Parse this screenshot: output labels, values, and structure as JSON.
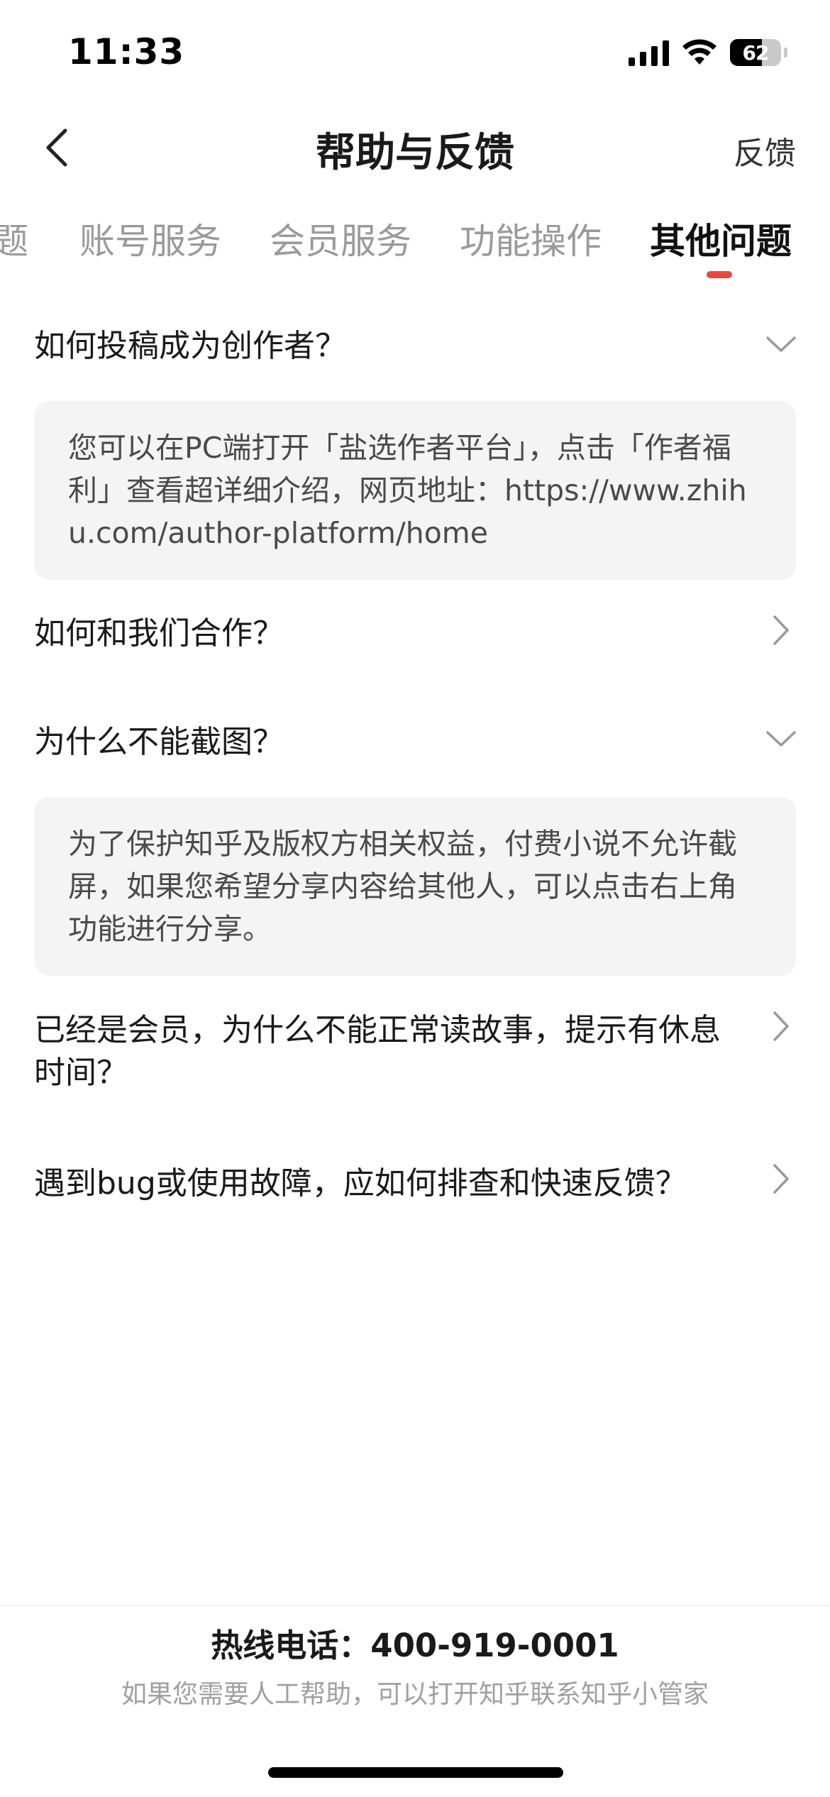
{
  "status_bar": {
    "time": "11:33",
    "battery_level": "62",
    "battery_fraction": 0.62,
    "icons": [
      "signal-icon",
      "wifi-icon",
      "battery-icon"
    ]
  },
  "nav": {
    "title": "帮助与反馈",
    "back_icon": "chevron-left-icon",
    "feedback_label": "反馈"
  },
  "tabs": [
    {
      "label": "题",
      "active": false
    },
    {
      "label": "账号服务",
      "active": false
    },
    {
      "label": "会员服务",
      "active": false
    },
    {
      "label": "功能操作",
      "active": false
    },
    {
      "label": "其他问题",
      "active": true
    }
  ],
  "faq": [
    {
      "question": "如何投稿成为创作者？",
      "expanded": true,
      "answer": "您可以在PC端打开「盐选作者平台」，点击「作者福利」查看超详细介绍，网页地址：https://www.zhihu.com/author-platform/home"
    },
    {
      "question": "如何和我们合作？",
      "expanded": false
    },
    {
      "question": "为什么不能截图？",
      "expanded": true,
      "answer": "为了保护知乎及版权方相关权益，付费小说不允许截屏，如果您希望分享内容给其他人，可以点击右上角功能进行分享。"
    },
    {
      "question": "已经是会员，为什么不能正常读故事，提示有休息时间？",
      "expanded": false
    },
    {
      "question": "遇到bug或使用故障，应如何排查和快速反馈？",
      "expanded": false
    }
  ],
  "footer": {
    "hotline": "热线电话：400-919-0001",
    "note": "如果您需要人工帮助，可以打开知乎联系知乎小管家"
  },
  "colors": {
    "accent": "#e8463f",
    "answer_bg": "#f4f4f4",
    "inactive_tab": "#9a9a9a"
  }
}
